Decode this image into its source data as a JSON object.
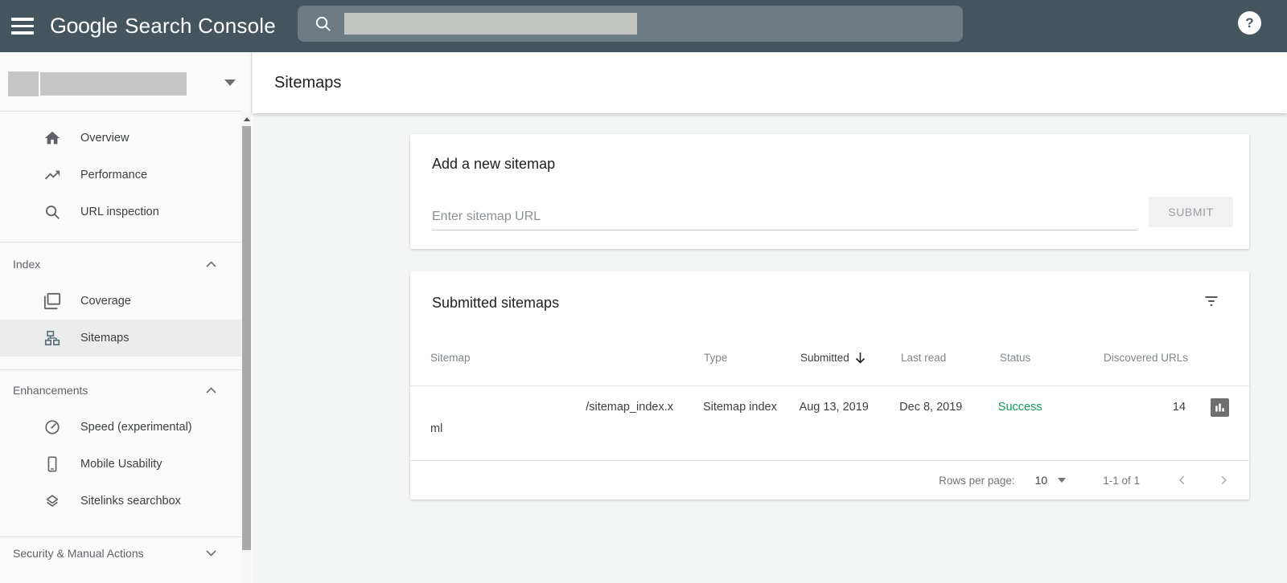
{
  "topbar": {
    "logo_primary": "Google",
    "logo_secondary": "Search Console",
    "help_glyph": "?"
  },
  "sidebar": {
    "nav": [
      {
        "label": "Overview"
      },
      {
        "label": "Performance"
      },
      {
        "label": "URL inspection"
      },
      {
        "label": "Coverage"
      },
      {
        "label": "Sitemaps"
      },
      {
        "label": "Speed (experimental)"
      },
      {
        "label": "Mobile Usability"
      },
      {
        "label": "Sitelinks searchbox"
      }
    ],
    "sections": {
      "index": "Index",
      "enhancements": "Enhancements",
      "security": "Security & Manual Actions"
    }
  },
  "page": {
    "title": "Sitemaps"
  },
  "add_card": {
    "title": "Add a new sitemap",
    "input_placeholder": "Enter sitemap URL",
    "input_value": "",
    "submit_label": "SUBMIT"
  },
  "table_card": {
    "title": "Submitted sitemaps",
    "columns": [
      "Sitemap",
      "Type",
      "Submitted",
      "Last read",
      "Status",
      "Discovered URLs"
    ],
    "sort_column": "Submitted",
    "row": {
      "sitemap_line1": "/sitemap_index.x",
      "sitemap_line2": "ml",
      "type": "Sitemap index",
      "submitted": "Aug 13, 2019",
      "last_read": "Dec 8, 2019",
      "status": "Success",
      "discovered_urls": "14"
    },
    "pagination": {
      "rows_per_page_label": "Rows per page:",
      "rows_per_page_value": "10",
      "range": "1-1 of 1"
    }
  },
  "colors": {
    "topbar_bg": "#45555e",
    "success_green": "#0f9d58",
    "selected_nav_bg": "#ececec",
    "redacted_gray": "#c6c6c6"
  }
}
